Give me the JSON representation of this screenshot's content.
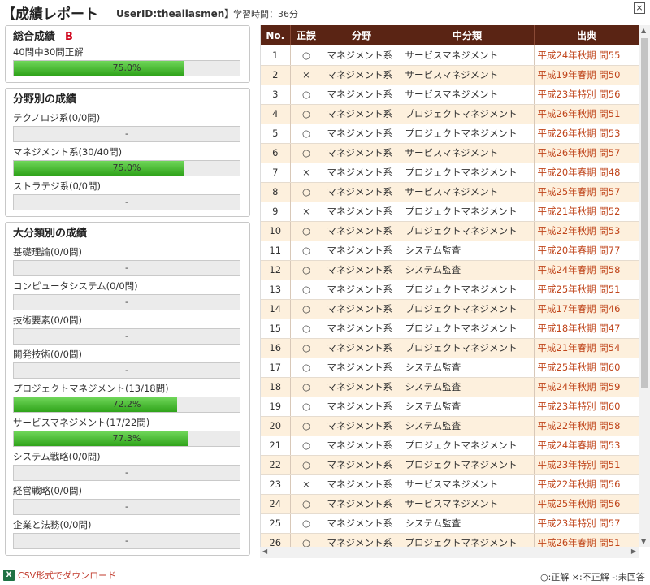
{
  "header": {
    "title": "【成績レポート",
    "user_id": "UserID:thealiasmen】",
    "study_time": "学習時間：36分",
    "close_label": "×"
  },
  "overall": {
    "title": "総合成績",
    "grade": "B",
    "summary": "40問中30問正解",
    "percent": 75.0,
    "percent_label": "75.0%"
  },
  "by_field": {
    "title": "分野別の成績",
    "items": [
      {
        "label": "テクノロジ系(0/0問)",
        "percent": 0,
        "value_label": "-"
      },
      {
        "label": "マネジメント系(30/40問)",
        "percent": 75.0,
        "value_label": "75.0%"
      },
      {
        "label": "ストラテジ系(0/0問)",
        "percent": 0,
        "value_label": "-"
      }
    ]
  },
  "by_major": {
    "title": "大分類別の成績",
    "items": [
      {
        "label": "基礎理論(0/0問)",
        "percent": 0,
        "value_label": "-"
      },
      {
        "label": "コンピュータシステム(0/0問)",
        "percent": 0,
        "value_label": "-"
      },
      {
        "label": "技術要素(0/0問)",
        "percent": 0,
        "value_label": "-"
      },
      {
        "label": "開発技術(0/0問)",
        "percent": 0,
        "value_label": "-"
      },
      {
        "label": "プロジェクトマネジメント(13/18問)",
        "percent": 72.2,
        "value_label": "72.2%"
      },
      {
        "label": "サービスマネジメント(17/22問)",
        "percent": 77.3,
        "value_label": "77.3%"
      },
      {
        "label": "システム戦略(0/0問)",
        "percent": 0,
        "value_label": "-"
      },
      {
        "label": "経営戦略(0/0問)",
        "percent": 0,
        "value_label": "-"
      },
      {
        "label": "企業と法務(0/0問)",
        "percent": 0,
        "value_label": "-"
      }
    ]
  },
  "csv_label": "CSV形式でダウンロード",
  "table": {
    "headers": [
      "No.",
      "正誤",
      "分野",
      "中分類",
      "出典"
    ],
    "rows": [
      [
        "1",
        "○",
        "マネジメント系",
        "サービスマネジメント",
        "平成24年秋期 問55"
      ],
      [
        "2",
        "×",
        "マネジメント系",
        "サービスマネジメント",
        "平成19年春期 問50"
      ],
      [
        "3",
        "○",
        "マネジメント系",
        "サービスマネジメント",
        "平成23年特別 問56"
      ],
      [
        "4",
        "○",
        "マネジメント系",
        "プロジェクトマネジメント",
        "平成26年秋期 問51"
      ],
      [
        "5",
        "○",
        "マネジメント系",
        "プロジェクトマネジメント",
        "平成26年秋期 問53"
      ],
      [
        "6",
        "○",
        "マネジメント系",
        "サービスマネジメント",
        "平成26年秋期 問57"
      ],
      [
        "7",
        "×",
        "マネジメント系",
        "プロジェクトマネジメント",
        "平成20年春期 問48"
      ],
      [
        "8",
        "○",
        "マネジメント系",
        "サービスマネジメント",
        "平成25年春期 問57"
      ],
      [
        "9",
        "×",
        "マネジメント系",
        "プロジェクトマネジメント",
        "平成21年秋期 問52"
      ],
      [
        "10",
        "○",
        "マネジメント系",
        "プロジェクトマネジメント",
        "平成22年秋期 問53"
      ],
      [
        "11",
        "○",
        "マネジメント系",
        "システム監査",
        "平成20年春期 問77"
      ],
      [
        "12",
        "○",
        "マネジメント系",
        "システム監査",
        "平成24年春期 問58"
      ],
      [
        "13",
        "○",
        "マネジメント系",
        "プロジェクトマネジメント",
        "平成25年秋期 問51"
      ],
      [
        "14",
        "○",
        "マネジメント系",
        "プロジェクトマネジメント",
        "平成17年春期 問46"
      ],
      [
        "15",
        "○",
        "マネジメント系",
        "プロジェクトマネジメント",
        "平成18年秋期 問47"
      ],
      [
        "16",
        "○",
        "マネジメント系",
        "プロジェクトマネジメント",
        "平成21年春期 問54"
      ],
      [
        "17",
        "○",
        "マネジメント系",
        "システム監査",
        "平成25年秋期 問60"
      ],
      [
        "18",
        "○",
        "マネジメント系",
        "システム監査",
        "平成24年秋期 問59"
      ],
      [
        "19",
        "○",
        "マネジメント系",
        "システム監査",
        "平成23年特別 問60"
      ],
      [
        "20",
        "○",
        "マネジメント系",
        "システム監査",
        "平成22年秋期 問58"
      ],
      [
        "21",
        "○",
        "マネジメント系",
        "プロジェクトマネジメント",
        "平成24年春期 問53"
      ],
      [
        "22",
        "○",
        "マネジメント系",
        "プロジェクトマネジメント",
        "平成23年特別 問51"
      ],
      [
        "23",
        "×",
        "マネジメント系",
        "サービスマネジメント",
        "平成22年秋期 問56"
      ],
      [
        "24",
        "○",
        "マネジメント系",
        "サービスマネジメント",
        "平成25年秋期 問56"
      ],
      [
        "25",
        "○",
        "マネジメント系",
        "システム監査",
        "平成23年特別 問57"
      ],
      [
        "26",
        "○",
        "マネジメント系",
        "プロジェクトマネジメント",
        "平成26年春期 問51"
      ]
    ]
  },
  "legend": "○:正解 ×:不正解 -:未回答",
  "colors": {
    "header_bg": "#5a2414",
    "row_alt": "#fdf0dd",
    "bar_green": "#3db526",
    "source_text": "#c0461c",
    "grade": "#d0021b"
  }
}
